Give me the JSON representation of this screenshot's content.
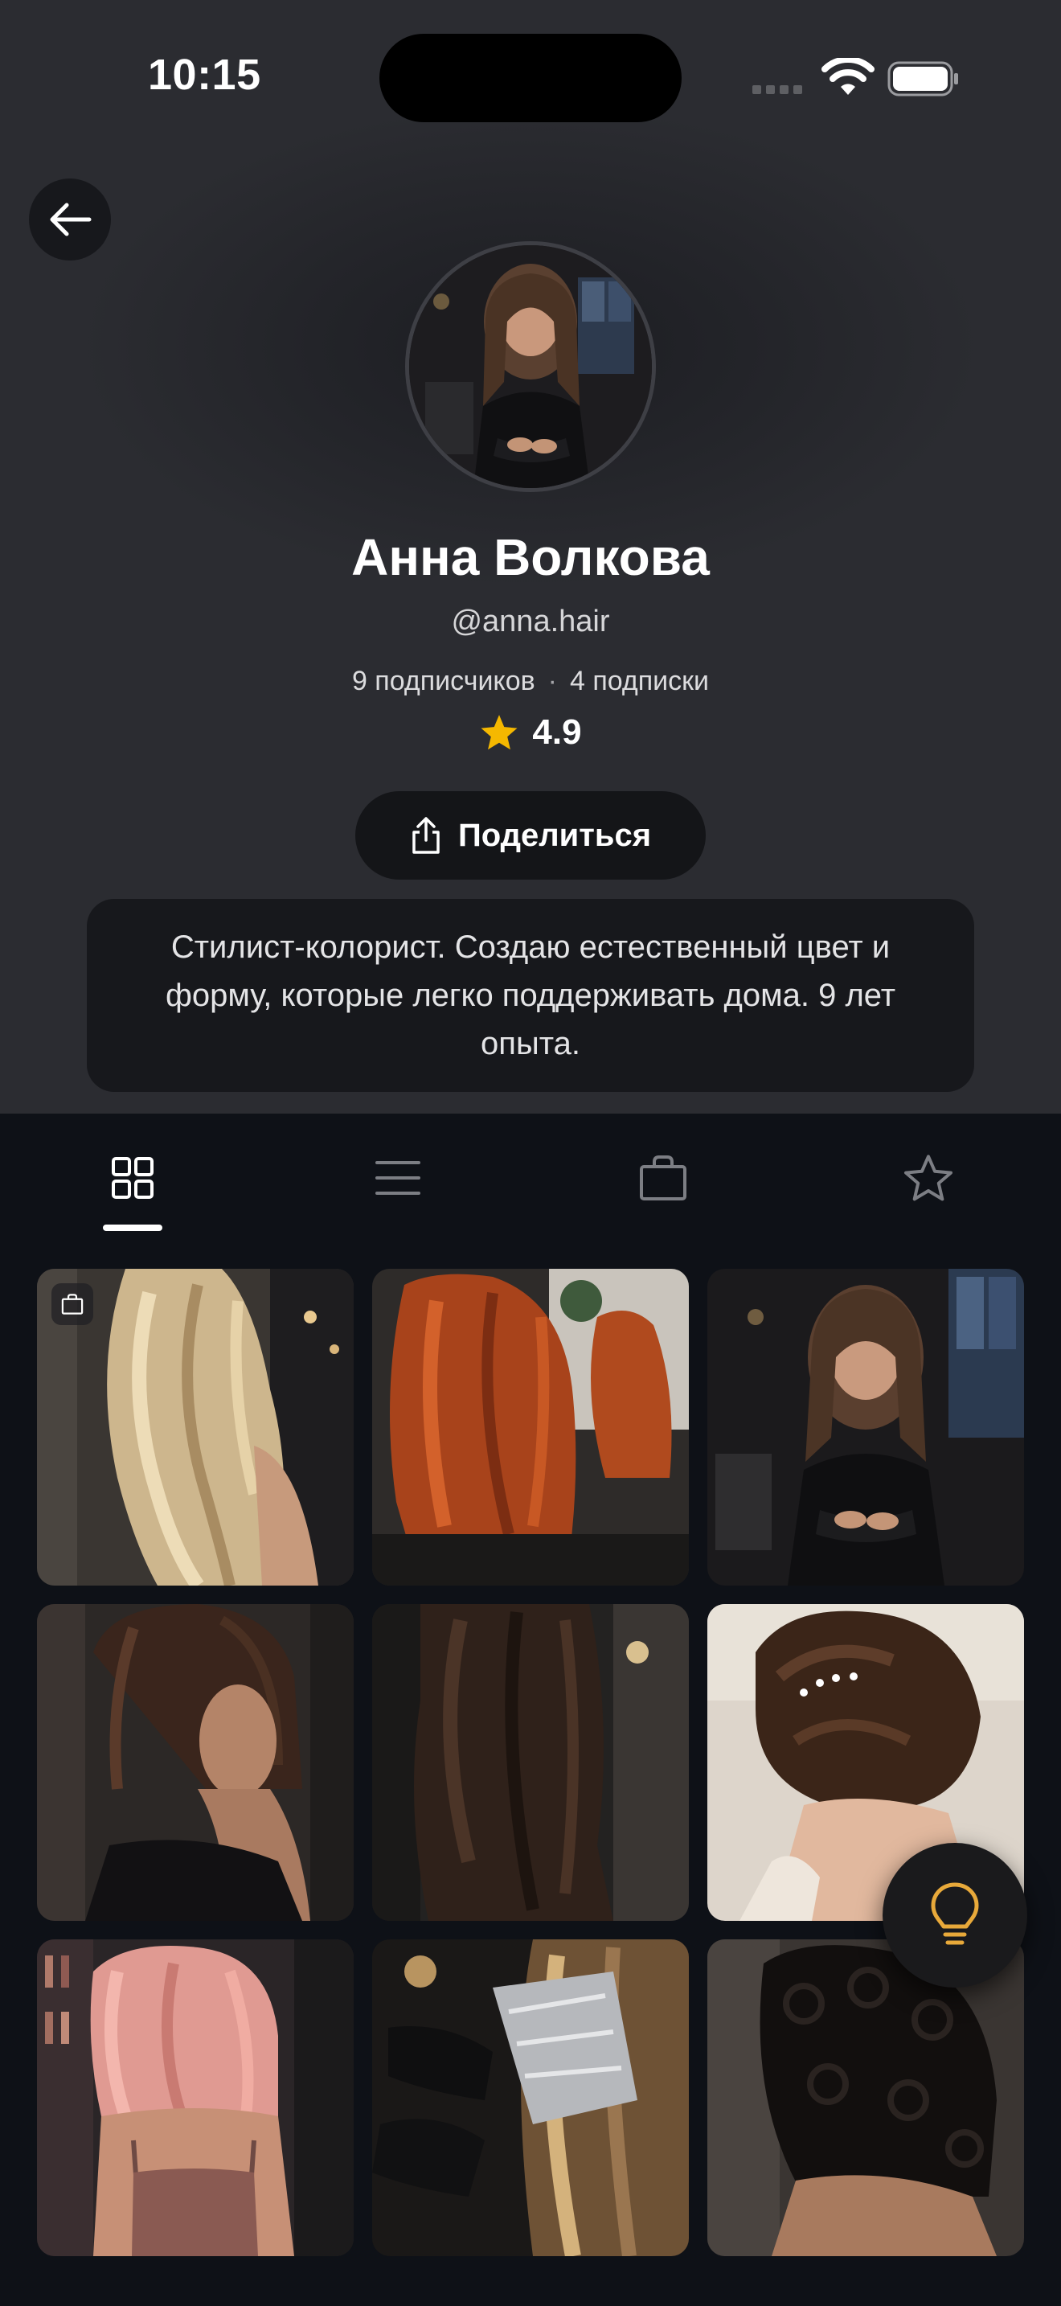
{
  "status_bar": {
    "time": "10:15"
  },
  "profile": {
    "name": "Анна Волкова",
    "handle": "@anna.hair",
    "followers": "9 подписчиков",
    "separator": "·",
    "following": "4 подписки",
    "rating": "4.9",
    "share_label": "Поделиться",
    "bio": "Стилист-колорист. Создаю естественный цвет и форму, которые легко поддерживать дома. 9 лет опыта."
  },
  "tabs": [
    {
      "icon": "grid-icon",
      "active": true
    },
    {
      "icon": "list-icon",
      "active": false
    },
    {
      "icon": "shopping-bag-icon",
      "active": false
    },
    {
      "icon": "star-outline-icon",
      "active": false
    }
  ],
  "gallery": [
    {
      "subject": "long wavy blonde hair",
      "shoppable": true
    },
    {
      "subject": "copper red wavy hair",
      "shoppable": false
    },
    {
      "subject": "stylist portrait",
      "shoppable": false
    },
    {
      "subject": "dark brown bob",
      "shoppable": false
    },
    {
      "subject": "long dark brown waves",
      "shoppable": false
    },
    {
      "subject": "updo with hairpins",
      "shoppable": false
    },
    {
      "subject": "pink wavy hair",
      "shoppable": false
    },
    {
      "subject": "foil highlighting process",
      "shoppable": false
    },
    {
      "subject": "black curly hair",
      "shoppable": false
    }
  ],
  "colors": {
    "accent_star": "#F5B800",
    "fab_icon": "#E8A93A",
    "background": "#0E1117",
    "header_bg": "#2B2C31"
  }
}
